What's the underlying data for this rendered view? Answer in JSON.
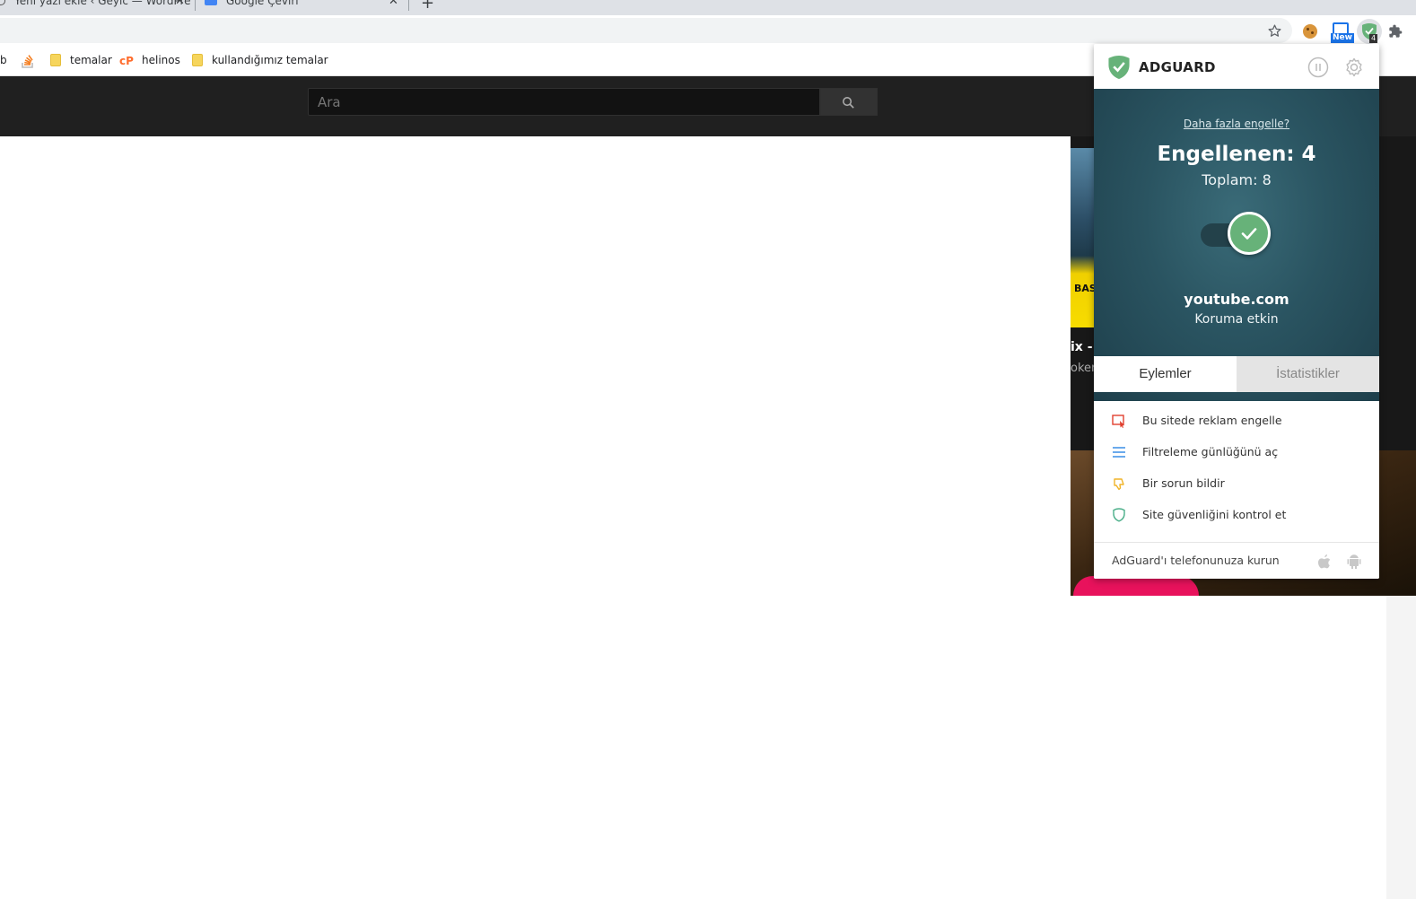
{
  "browser": {
    "tabs": [
      {
        "title": "Yeni yazı ekle ‹ Geyic — WordPre",
        "close": "✕"
      },
      {
        "title": "Google Çeviri",
        "close": "✕"
      }
    ],
    "new_tab": "+",
    "bookmarks": [
      {
        "label": "b"
      },
      {
        "label": "temalar"
      },
      {
        "label": "helinos"
      },
      {
        "label": "kullandığımız temalar"
      }
    ],
    "extension_badge_new": "New",
    "extension_badge_count": "4"
  },
  "youtube": {
    "search_placeholder": "Ara",
    "thumb_text": "BAS",
    "video_title_fragment": "ix -",
    "video_sub_fragment": "oker,"
  },
  "adguard": {
    "brand": "ADGUARD",
    "more_link": "Daha fazla engelle?",
    "blocked": "Engellenen: 4",
    "total": "Toplam: 8",
    "site": "youtube.com",
    "status": "Koruma etkin",
    "tabs": {
      "actions": "Eylemler",
      "stats": "İstatistikler"
    },
    "actions": [
      {
        "label": "Bu sitede reklam engelle",
        "icon": "block-element-icon"
      },
      {
        "label": "Filtreleme günlüğünü aç",
        "icon": "list-icon"
      },
      {
        "label": "Bir sorun bildir",
        "icon": "thumbs-down-icon"
      },
      {
        "label": "Site güvenliğini kontrol et",
        "icon": "shield-icon"
      }
    ],
    "footer": "AdGuard'ı telefonunuza kurun",
    "colors": {
      "hero": "#2a5461",
      "green": "#67b279",
      "red": "#e0402f",
      "blue": "#3a8ee6",
      "yellow": "#f0b429",
      "teal": "#4caf8a"
    }
  }
}
